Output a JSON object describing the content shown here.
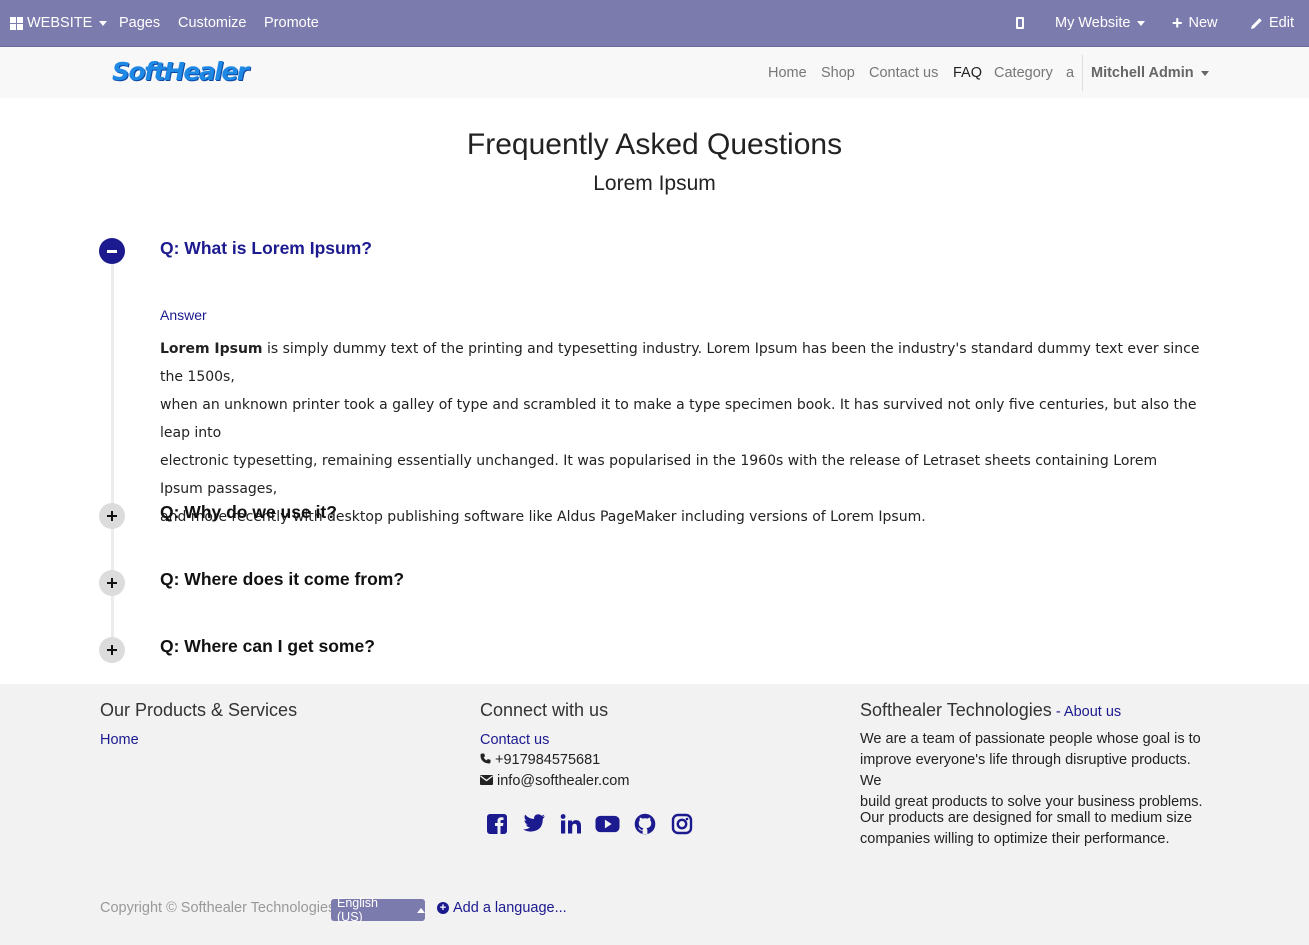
{
  "adminbar": {
    "website_label": "WEBSITE",
    "pages_label": "Pages",
    "customize_label": "Customize",
    "promote_label": "Promote",
    "site_switcher_label": "My Website",
    "new_label": "New",
    "edit_label": "Edit"
  },
  "header": {
    "logo_text": "SoftHealer",
    "nav": [
      "Home",
      "Shop",
      "Contact us",
      "FAQ",
      "Category",
      "a"
    ],
    "active_nav": "FAQ",
    "user_label": "Mitchell Admin"
  },
  "faq": {
    "title": "Frequently Asked Questions",
    "subtitle": "Lorem Ipsum",
    "items": [
      {
        "question": "Q: What is Lorem Ipsum?",
        "expanded": true,
        "answer_label": "Answer",
        "answer_bold": "Lorem Ipsum",
        "answer_lines": [
          " is simply dummy text of the printing and typesetting industry. Lorem Ipsum has been the industry's standard dummy text ever since the 1500s,",
          "when an unknown printer took a galley of type and scrambled it to make a type specimen book. It has survived not only five centuries, but also the leap into",
          "electronic typesetting, remaining essentially unchanged. It was popularised in the 1960s with the release of Letraset sheets containing Lorem Ipsum passages,",
          "and more recently with desktop publishing software like Aldus PageMaker including versions of Lorem Ipsum."
        ]
      },
      {
        "question": "Q: Why do we use it?",
        "expanded": false
      },
      {
        "question": "Q: Where does it come from?",
        "expanded": false
      },
      {
        "question": "Q: Where can I get some?",
        "expanded": false
      }
    ]
  },
  "footer": {
    "products": {
      "heading": "Our Products & Services",
      "links": [
        "Home"
      ]
    },
    "connect": {
      "heading": "Connect with us",
      "contact_link": "Contact us",
      "phone": "+917984575681",
      "email": "info@softhealer.com",
      "social": [
        "facebook-icon",
        "twitter-icon",
        "linkedin-icon",
        "youtube-icon",
        "github-icon",
        "instagram-icon"
      ]
    },
    "company": {
      "heading": "Softhealer Technologies",
      "about_link": "About us",
      "about_sep": " - ",
      "para1_lines": [
        "We are a team of passionate people whose goal is to",
        "improve everyone's life through disruptive products. We",
        "build great products to solve your business problems."
      ],
      "para2_lines": [
        "Our products are designed for small to medium size",
        "companies willing to optimize their performance."
      ]
    },
    "copyright": "Copyright © Softhealer Technologies",
    "language": "English (US)",
    "add_language": "Add a language..."
  },
  "colors": {
    "admin_bar": "#7c7bad",
    "accent": "#1c1a8f",
    "footer_bg": "#f2f2f2",
    "header_bg": "#f8f8f8"
  }
}
